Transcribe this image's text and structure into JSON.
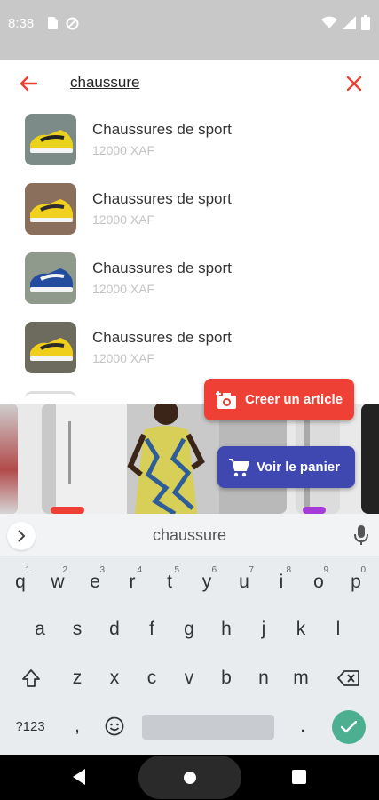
{
  "status": {
    "time": "8:38"
  },
  "search": {
    "query": "chaussure"
  },
  "results": [
    {
      "title": "Chaussures de sport",
      "price": "12000 XAF",
      "shoe_color": "#e8d21c",
      "accent": "#222222",
      "bg": "#7c8a88"
    },
    {
      "title": "Chaussures de sport",
      "price": "12000 XAF",
      "shoe_color": "#f0d020",
      "accent": "#2e2e2e",
      "bg": "#8a6f5c"
    },
    {
      "title": "Chaussures de sport",
      "price": "12000 XAF",
      "shoe_color": "#234c9e",
      "accent": "#f2f2f2",
      "bg": "#8f9a8c"
    },
    {
      "title": "Chaussures de sport",
      "price": "12000 XAF",
      "shoe_color": "#f0cf1c",
      "accent": "#2b2b2b",
      "bg": "#6d6a5e"
    }
  ],
  "fabs": {
    "create_label": "Creer un article",
    "cart_label": "Voir le panier"
  },
  "keyboard": {
    "suggestion": "chaussure",
    "row1": [
      {
        "k": "q",
        "n": "1"
      },
      {
        "k": "w",
        "n": "2"
      },
      {
        "k": "e",
        "n": "3"
      },
      {
        "k": "r",
        "n": "4"
      },
      {
        "k": "t",
        "n": "5"
      },
      {
        "k": "y",
        "n": "6"
      },
      {
        "k": "u",
        "n": "7"
      },
      {
        "k": "i",
        "n": "8"
      },
      {
        "k": "o",
        "n": "9"
      },
      {
        "k": "p",
        "n": "0"
      }
    ],
    "row2": [
      "a",
      "s",
      "d",
      "f",
      "g",
      "h",
      "j",
      "k",
      "l"
    ],
    "row3": [
      "z",
      "x",
      "c",
      "v",
      "b",
      "n",
      "m"
    ],
    "symbols_label": "?123",
    "comma": ",",
    "period": "."
  },
  "colors": {
    "accent_red": "#ee4035",
    "accent_blue": "#3f48b0",
    "enter_green": "#4caf8f"
  }
}
